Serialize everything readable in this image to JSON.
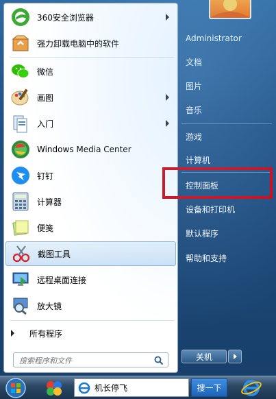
{
  "left_items": [
    {
      "label": "360安全浏览器",
      "icon": "360-browser-icon",
      "has_arrow": true
    },
    {
      "label": "强力卸载电脑中的软件",
      "icon": "uninstaller-icon",
      "has_arrow": false
    },
    {
      "label": "微信",
      "icon": "wechat-icon",
      "has_arrow": false
    },
    {
      "label": "画图",
      "icon": "paint-icon",
      "has_arrow": true
    },
    {
      "label": "入门",
      "icon": "getting-started-icon",
      "has_arrow": true
    },
    {
      "label": "Windows Media Center",
      "icon": "media-center-icon",
      "has_arrow": false
    },
    {
      "label": "钉钉",
      "icon": "dingtalk-icon",
      "has_arrow": false
    },
    {
      "label": "计算器",
      "icon": "calculator-icon",
      "has_arrow": false
    },
    {
      "label": "便笺",
      "icon": "sticky-notes-icon",
      "has_arrow": false
    },
    {
      "label": "截图工具",
      "icon": "snipping-tool-icon",
      "has_arrow": false,
      "selected": true
    },
    {
      "label": "远程桌面连接",
      "icon": "remote-desktop-icon",
      "has_arrow": false
    },
    {
      "label": "放大镜",
      "icon": "magnifier-icon",
      "has_arrow": false
    }
  ],
  "all_programs": "所有程序",
  "search": {
    "placeholder": "搜索程序和文件"
  },
  "right_items": [
    {
      "label": "Administrator"
    },
    {
      "label": "文档"
    },
    {
      "label": "图片"
    },
    {
      "label": "音乐"
    },
    {
      "label": "游戏"
    },
    {
      "label": "计算机"
    },
    {
      "label": "控制面板",
      "highlighted": true
    },
    {
      "label": "设备和打印机"
    },
    {
      "label": "默认程序"
    },
    {
      "label": "帮助和支持"
    }
  ],
  "shutdown": {
    "label": "关机"
  },
  "taskbar": {
    "window_label": "机长停飞",
    "search_button": "搜一下"
  },
  "colors": {
    "highlight_border": "#d2000b",
    "selected_bg": "#cfe3f6"
  }
}
